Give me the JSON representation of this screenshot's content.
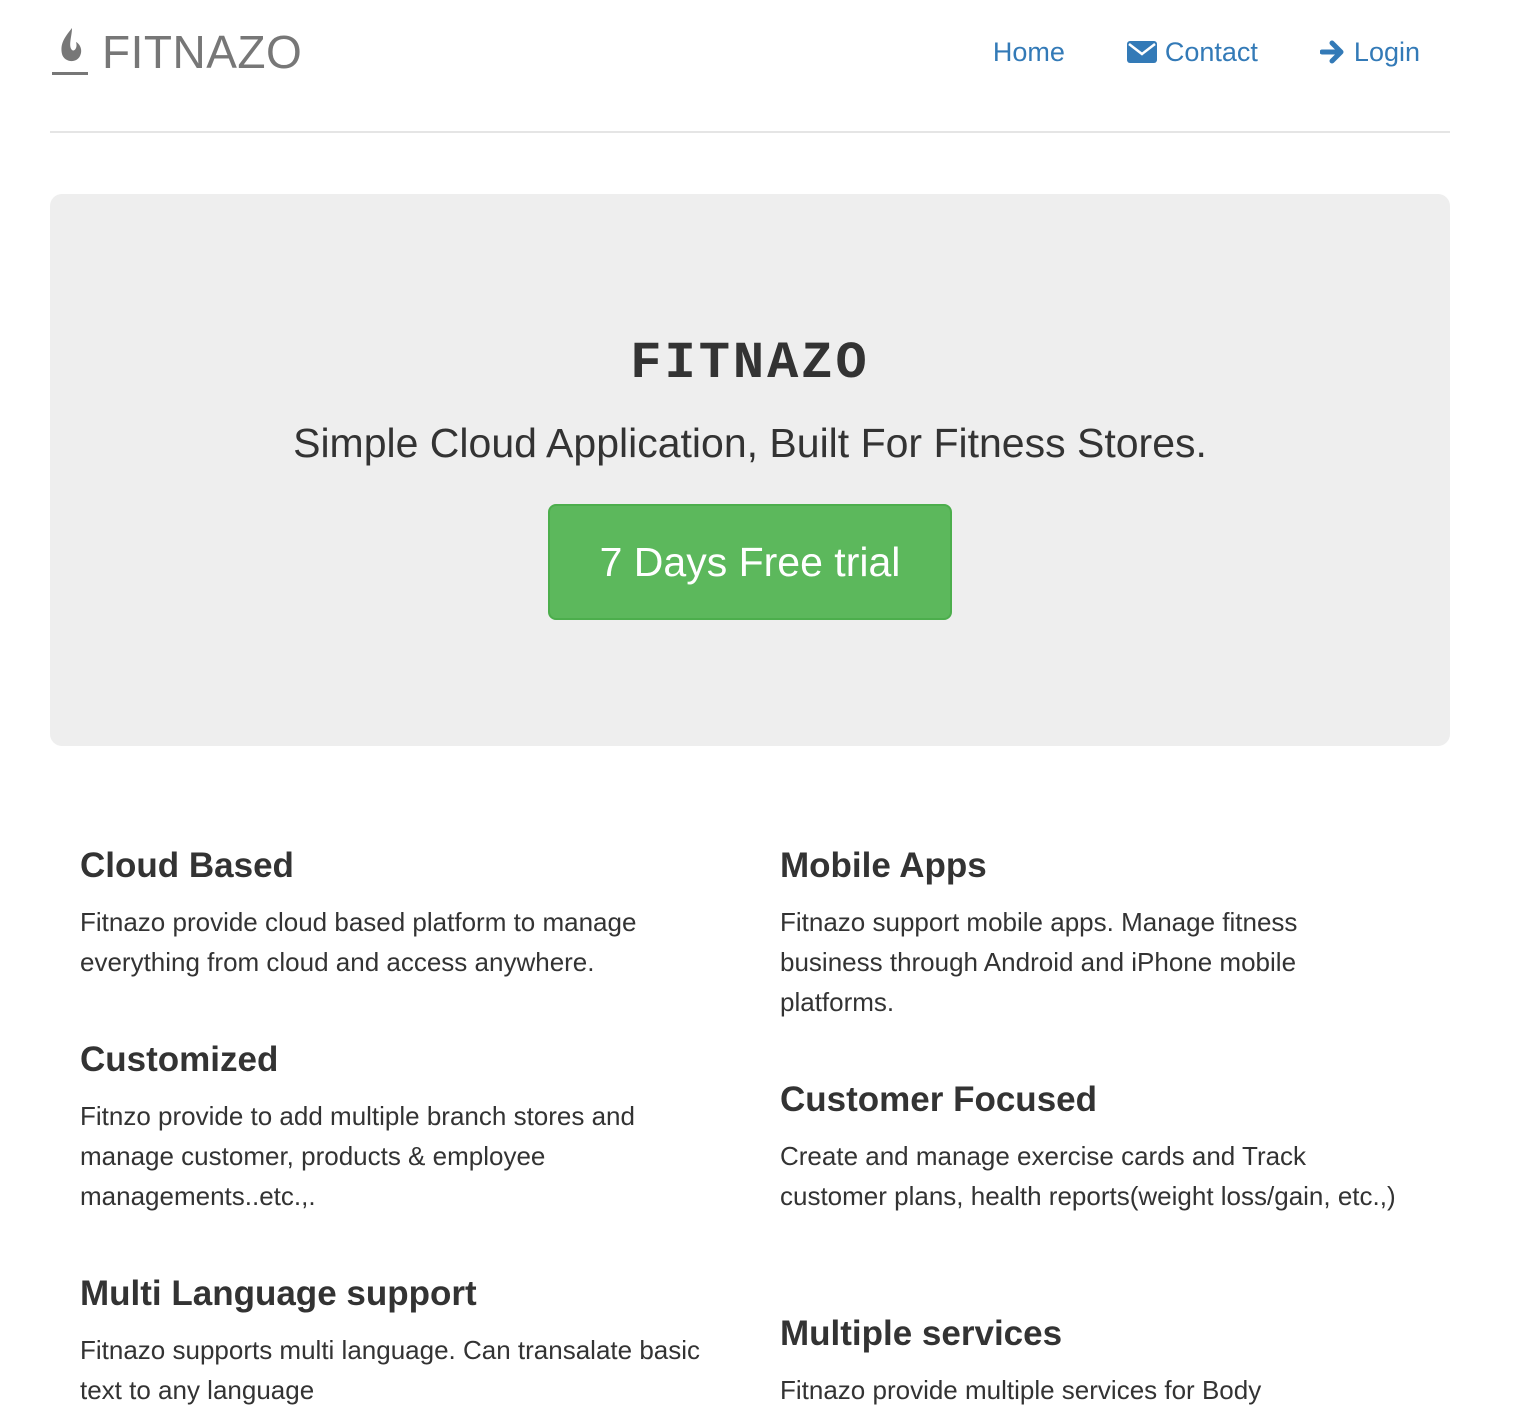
{
  "header": {
    "brand": "FITNAZO",
    "nav": {
      "home": "Home",
      "contact": "Contact",
      "login": "Login"
    },
    "link_color": "#337ab7"
  },
  "hero": {
    "title": "FITNAZO",
    "tagline": "Simple Cloud Application, Built For Fitness Stores.",
    "cta_label": "7 Days Free trial",
    "cta_color": "#5cb85c"
  },
  "features": {
    "left": [
      {
        "title": "Cloud Based",
        "text": "Fitnazo provide cloud based platform to manage everything from cloud and access anywhere."
      },
      {
        "title": "Customized",
        "text": "Fitnzo provide to add multiple branch stores and manage customer, products & employee managements..etc.,."
      },
      {
        "title": "Multi Language support",
        "text": "Fitnazo supports multi language. Can transalate basic text to any language"
      }
    ],
    "right": [
      {
        "title": "Mobile Apps",
        "text": "Fitnazo support mobile apps. Manage fitness business through Android and iPhone mobile platforms."
      },
      {
        "title": "Customer Focused",
        "text": "Create and manage exercise cards and Track customer plans, health reports(weight loss/gain, etc.,)"
      },
      {
        "title": "Multiple services",
        "text": "Fitnazo provide multiple services for Body"
      }
    ]
  }
}
